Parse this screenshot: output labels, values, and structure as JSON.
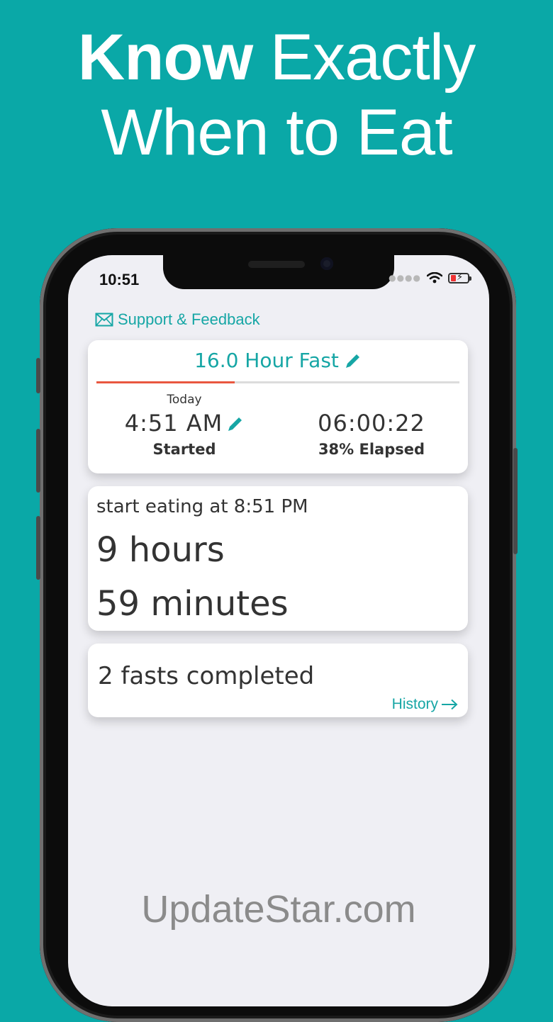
{
  "headline": {
    "line1_bold": "Know",
    "line1_light": "Exactly",
    "line2": "When to Eat"
  },
  "status_bar": {
    "time": "10:51"
  },
  "support": {
    "label": "Support & Feedback"
  },
  "fast_card": {
    "title": "16.0 Hour Fast",
    "progress_percent": 38,
    "start_day": "Today",
    "start_time": "4:51 AM",
    "start_caption": "Started",
    "elapsed_time": "06:00:22",
    "elapsed_caption": "38% Elapsed"
  },
  "eating_card": {
    "eat_at": "start eating at 8:51 PM",
    "hours": "9 hours",
    "minutes": "59 minutes"
  },
  "history_card": {
    "count_text": "2 fasts completed",
    "history_link": "History"
  },
  "watermark": "UpdateStar.com",
  "colors": {
    "background": "#0aa8a7",
    "accent": "#16a6a5",
    "progress": "#e9573f"
  }
}
